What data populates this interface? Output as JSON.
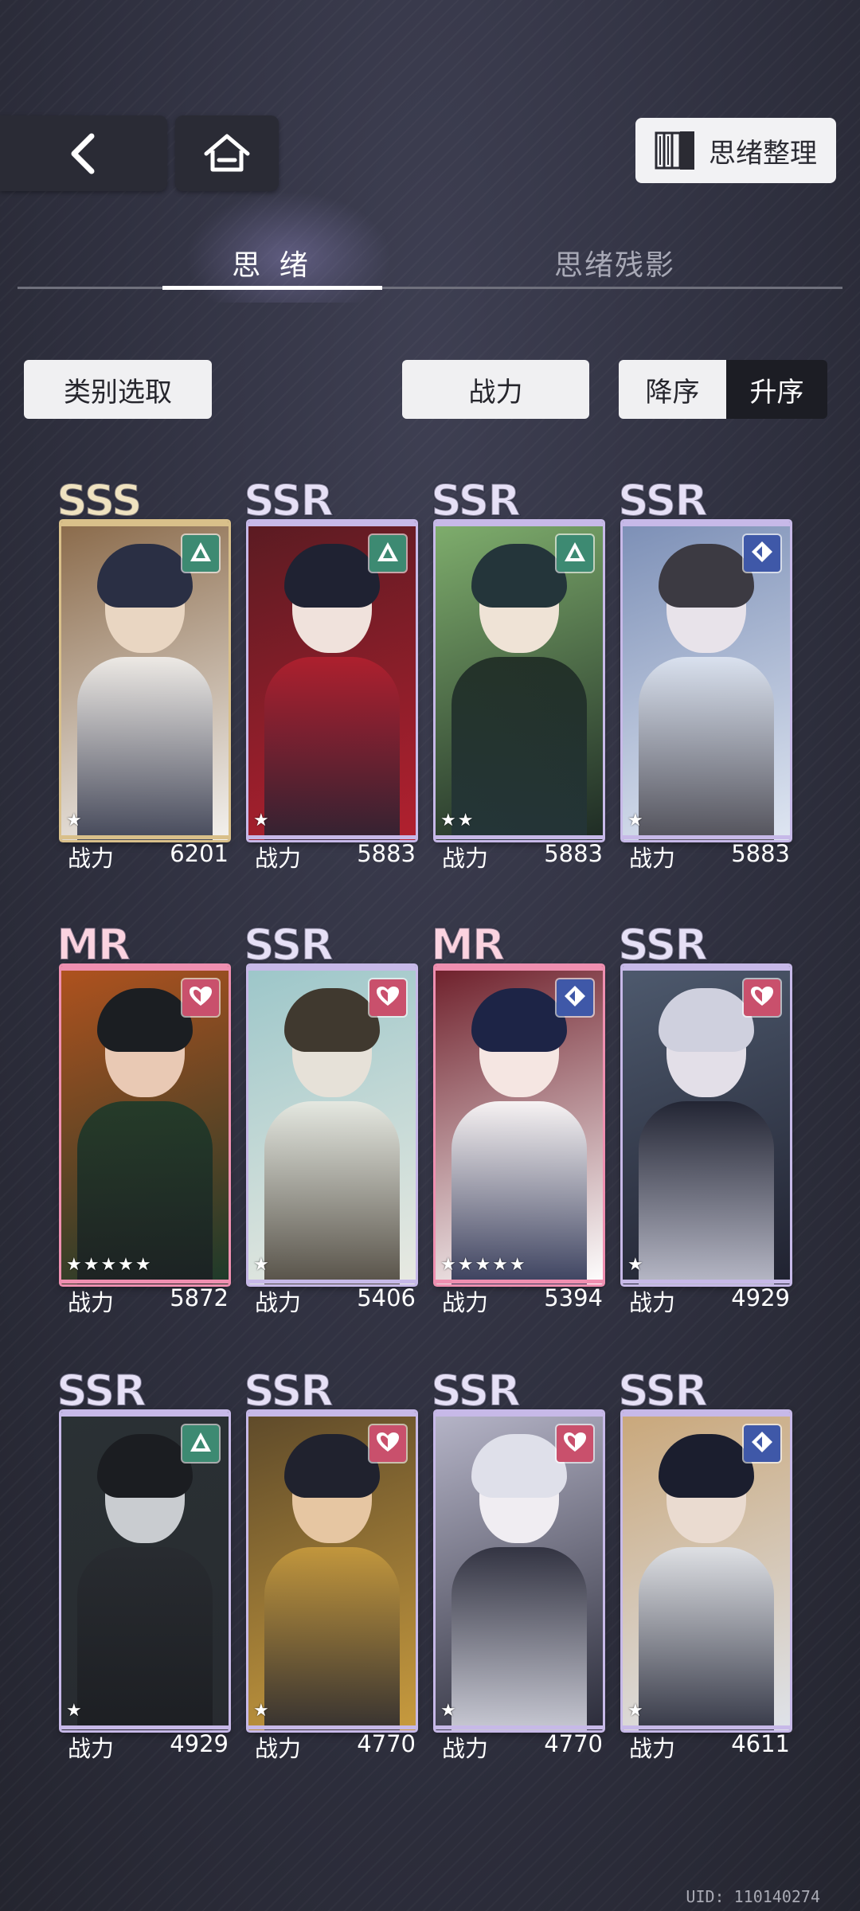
{
  "header": {
    "organize_label": "思绪整理"
  },
  "tabs": [
    {
      "label": "思 绪",
      "active": true
    },
    {
      "label": "思绪残影",
      "active": false
    }
  ],
  "filters": {
    "category_label": "类别选取",
    "sort_by_label": "战力",
    "sort_desc_label": "降序",
    "sort_asc_label": "升序"
  },
  "card_power_label": "战力",
  "cards": [
    {
      "rarity": "SSS",
      "attribute": "triangle-green",
      "stars": 1,
      "power": "6201"
    },
    {
      "rarity": "SSR",
      "attribute": "triangle-green",
      "stars": 1,
      "power": "5883"
    },
    {
      "rarity": "SSR",
      "attribute": "triangle-green",
      "stars": 2,
      "power": "5883"
    },
    {
      "rarity": "SSR",
      "attribute": "diamond-blue",
      "stars": 1,
      "power": "5883"
    },
    {
      "rarity": "MR",
      "attribute": "heart-pink",
      "stars": 5,
      "power": "5872"
    },
    {
      "rarity": "SSR",
      "attribute": "heart-pink",
      "stars": 1,
      "power": "5406"
    },
    {
      "rarity": "MR",
      "attribute": "diamond-blue",
      "stars": 5,
      "power": "5394"
    },
    {
      "rarity": "SSR",
      "attribute": "heart-pink",
      "stars": 1,
      "power": "4929"
    },
    {
      "rarity": "SSR",
      "attribute": "triangle-green",
      "stars": 1,
      "power": "4929"
    },
    {
      "rarity": "SSR",
      "attribute": "heart-pink",
      "stars": 1,
      "power": "4770"
    },
    {
      "rarity": "SSR",
      "attribute": "heart-pink",
      "stars": 1,
      "power": "4770"
    },
    {
      "rarity": "SSR",
      "attribute": "diamond-blue",
      "stars": 1,
      "power": "4611"
    }
  ],
  "uid_text": "UID: 110140274",
  "colors": {
    "background": "#2f303f",
    "attr_green": "#3d8a72",
    "attr_pink": "#c9506c",
    "attr_blue": "#3f58a8"
  }
}
